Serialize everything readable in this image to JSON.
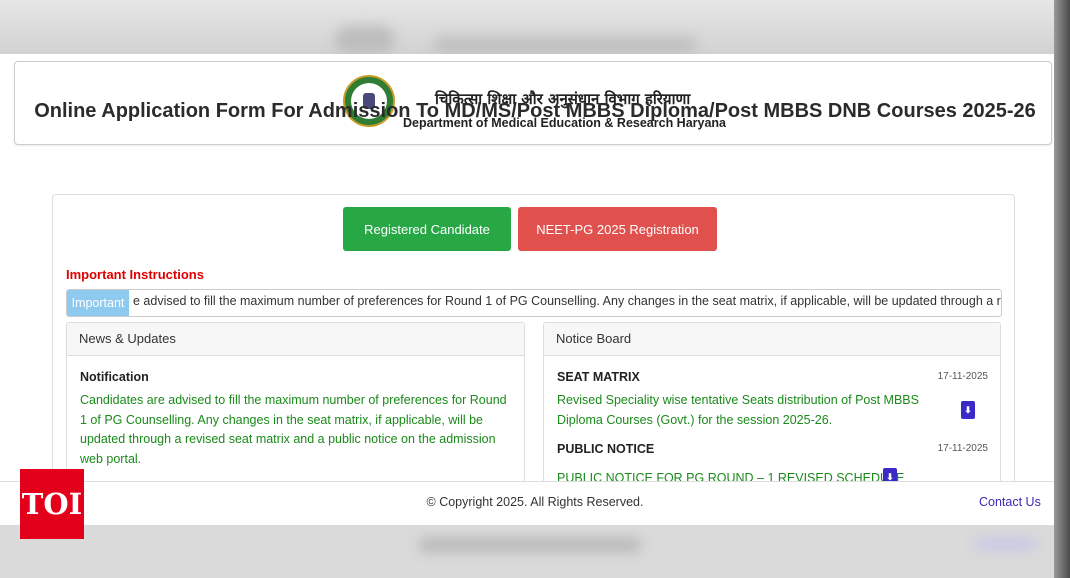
{
  "header": {
    "hindi_title": "चिकित्सा शिक्षा और अनुसंधान विभाग हरियाणा",
    "english_title": "Department of Medical Education & Research Haryana"
  },
  "page_title": "Online Application Form For Admission To MD/MS/Post MBBS Diploma/Post MBBS DNB Courses 2025-26",
  "buttons": {
    "registered": "Registered Candidate",
    "neet": "NEET-PG 2025 Registration"
  },
  "instructions": {
    "heading": "Important Instructions",
    "badge": "Important",
    "marquee_text": "e advised to fill the maximum number of preferences for Round 1 of PG Counselling. Any changes in the seat matrix, if applicable, will be updated through a r"
  },
  "news": {
    "header": "News & Updates",
    "item_title": "Notification",
    "item_body": "Candidates are advised to fill the maximum number of preferences for Round 1 of PG Counselling. Any changes in the seat matrix, if applicable, will be updated through a revised seat matrix and a public notice on the admission web portal."
  },
  "notice_board": {
    "header": "Notice Board",
    "items": [
      {
        "title": "SEAT MATRIX",
        "date": "17-11-2025",
        "desc": "Revised Speciality wise tentative Seats distribution of Post MBBS Diploma Courses (Govt.) for the session 2025-26."
      },
      {
        "title": "PUBLIC NOTICE",
        "date": "17-11-2025",
        "desc": "PUBLIC NOTICE FOR PG ROUND – 1 REVISED SCHEDULE"
      }
    ]
  },
  "footer": {
    "copyright": "© Copyright 2025. All Rights Reserved.",
    "contact": "Contact Us"
  },
  "watermark": "TOI",
  "icons": [
    "pdf-icon",
    "department-logo"
  ],
  "colors": {
    "green": "#28a745",
    "red": "#e0504c",
    "badge": "#8ec9ef",
    "link": "#3a2ab8",
    "text_green": "#1a8a1a"
  }
}
